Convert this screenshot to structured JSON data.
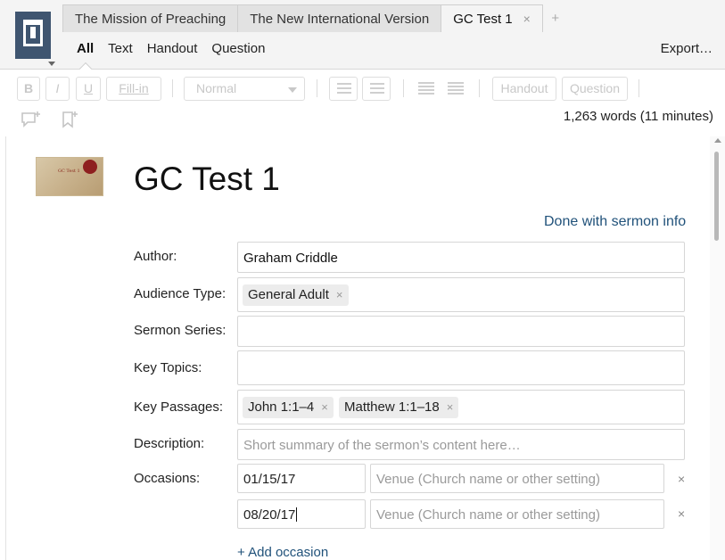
{
  "tabs": [
    {
      "label": "The Mission of Preaching"
    },
    {
      "label": "The New International Version"
    },
    {
      "label": "GC Test 1",
      "close": "×"
    }
  ],
  "tab_add": "+",
  "subnav": {
    "items": [
      "All",
      "Text",
      "Handout",
      "Question"
    ],
    "active": "All",
    "export": "Export…"
  },
  "toolbar": {
    "bold": "B",
    "italic": "I",
    "underline": "U",
    "fill_in": "Fill-in",
    "style_select": "Normal",
    "handout": "Handout",
    "question": "Question",
    "word_count": "1,263 words (11 minutes)"
  },
  "document": {
    "thumbnail_text": "GC Test 1",
    "title": "GC Test 1",
    "done_link": "Done with sermon info"
  },
  "fields": {
    "author": {
      "label": "Author:",
      "value": "Graham Criddle"
    },
    "audience": {
      "label": "Audience Type:",
      "chips": [
        "General Adult"
      ]
    },
    "series": {
      "label": "Sermon Series:",
      "value": ""
    },
    "topics": {
      "label": "Key Topics:",
      "value": ""
    },
    "passages": {
      "label": "Key Passages:",
      "chips": [
        "John 1:1–4",
        "Matthew 1:1–18"
      ]
    },
    "description": {
      "label": "Description:",
      "placeholder": "Short summary of the sermon’s content here…"
    },
    "occasions": {
      "label": "Occasions:",
      "rows": [
        {
          "date": "01/15/17",
          "venue_placeholder": "Venue (Church name or other setting)"
        },
        {
          "date": "08/20/17",
          "venue_placeholder": "Venue (Church name or other setting)"
        }
      ],
      "remove": "×",
      "add_label": "+ Add occasion"
    }
  },
  "colors": {
    "logo": "#3f5570",
    "link": "#21527a"
  }
}
